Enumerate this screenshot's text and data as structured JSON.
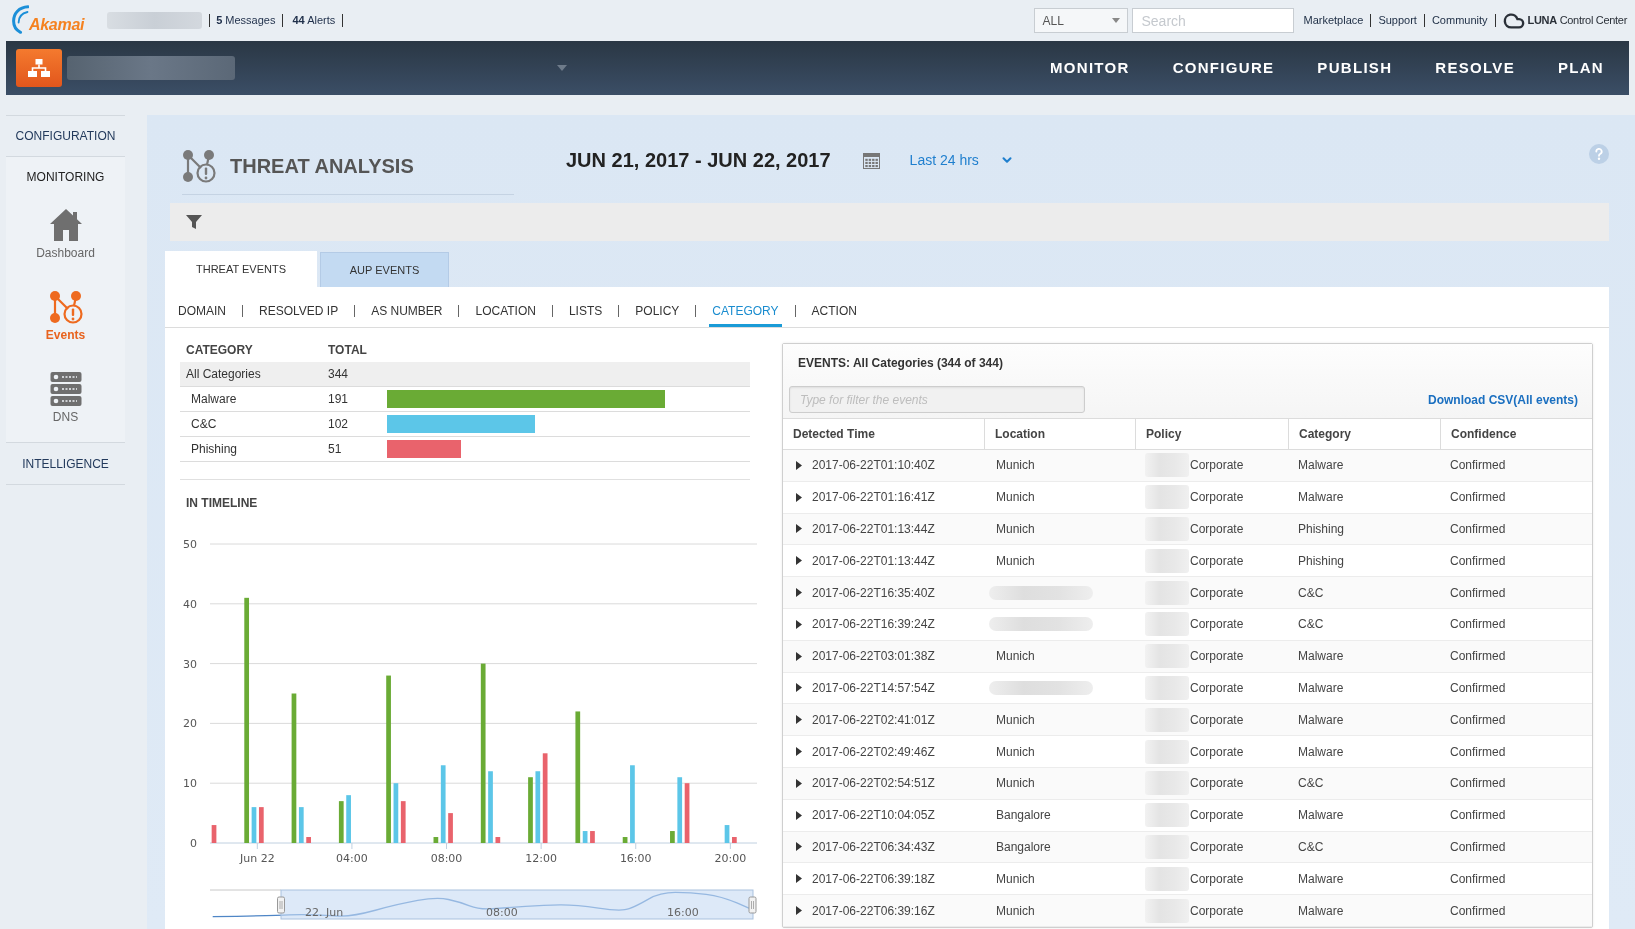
{
  "top_bar": {
    "logo": "Akamai",
    "messages": "**5** Messages",
    "alerts": "**44** Alerts",
    "scope_select": {
      "value": "ALL"
    },
    "search": {
      "placeholder": "Search"
    },
    "links": [
      "Marketplace",
      "Support",
      "Community"
    ],
    "product": "**LUNA** Control Center"
  },
  "nav": {
    "items": [
      "MONITOR",
      "CONFIGURE",
      "PUBLISH",
      "RESOLVE",
      "PLAN"
    ]
  },
  "sidebar": {
    "sections": [
      {
        "label": "CONFIGURATION",
        "expanded": false
      },
      {
        "label": "MONITORING",
        "expanded": true,
        "items": [
          {
            "label": "Dashboard",
            "kind": "house",
            "selected": false
          },
          {
            "label": "Events",
            "kind": "nodes",
            "selected": true
          },
          {
            "label": "DNS",
            "kind": "servers",
            "selected": false
          }
        ]
      },
      {
        "label": "INTELLIGENCE",
        "expanded": false
      }
    ]
  },
  "header": {
    "title": "THREAT ANALYSIS",
    "date_range": "JUN 21, 2017 - JUN 22, 2017",
    "period": "Last 24 hrs"
  },
  "tabs": [
    {
      "label": "THREAT EVENTS",
      "selected": true
    },
    {
      "label": "AUP EVENTS",
      "selected": false
    }
  ],
  "sub_tabs": [
    {
      "label": "DOMAIN",
      "selected": false
    },
    {
      "label": "RESOLVED IP",
      "selected": false
    },
    {
      "label": "AS NUMBER",
      "selected": false
    },
    {
      "label": "LOCATION",
      "selected": false
    },
    {
      "label": "LISTS",
      "selected": false
    },
    {
      "label": "POLICY",
      "selected": false
    },
    {
      "label": "CATEGORY",
      "selected": true
    },
    {
      "label": "ACTION",
      "selected": false
    }
  ],
  "category_table": {
    "columns": [
      "CATEGORY",
      "TOTAL"
    ],
    "rows": [
      {
        "name": "All Categories",
        "total": "344",
        "selected": true,
        "children": [
          {
            "name": "Malware",
            "total": "191",
            "color": "#6aab35",
            "selected": false
          },
          {
            "name": "C&C",
            "total": "102",
            "color": "#5cc6e8",
            "selected": false
          },
          {
            "name": "Phishing",
            "total": "51",
            "color": "#e9636c",
            "selected": false
          }
        ]
      }
    ]
  },
  "timeline": {
    "title": "IN TIMELINE",
    "chart_data": {
      "type": "bar",
      "x": [
        -2,
        0,
        2,
        4,
        6,
        8,
        10,
        12,
        14,
        16,
        18,
        20
      ],
      "series": [
        {
          "color": "#6aab35",
          "values": [
            0,
            41,
            25,
            7,
            28,
            1,
            30,
            11,
            22,
            1,
            2,
            0
          ]
        },
        {
          "color": "#5cc6e8",
          "values": [
            0,
            6,
            6,
            8,
            10,
            13,
            12,
            12,
            2,
            13,
            11,
            3
          ]
        },
        {
          "color": "#e9636c",
          "values": [
            3,
            6,
            1,
            0,
            7,
            5,
            1,
            15,
            2,
            0,
            10,
            1
          ]
        }
      ],
      "xlim": [
        -2,
        21
      ],
      "ylim": [
        0,
        50
      ],
      "xticks": [
        {
          "value": 0,
          "label": "Jun 22"
        },
        {
          "value": 4,
          "label": "04:00"
        },
        {
          "value": 8,
          "label": "08:00"
        },
        {
          "value": 12,
          "label": "12:00"
        },
        {
          "value": 16,
          "label": "16:00"
        },
        {
          "value": 20,
          "label": "20:00"
        }
      ],
      "yticks": [
        0,
        10,
        20,
        30,
        40,
        50
      ],
      "grid": true
    },
    "navigator": {
      "labels": [
        "22. Jun",
        "08:00",
        "16:00"
      ]
    }
  },
  "events": {
    "title": "EVENTS: All Categories (344 of 344)",
    "filter": {
      "placeholder": "Type for filter the events"
    },
    "download": "Download CSV(All events)",
    "columns": [
      "Detected Time",
      "Location",
      "Policy",
      "Category",
      "Confidence"
    ],
    "rows": [
      {
        "time": "2017-06-22T01:10:40Z",
        "location": "Munich",
        "policy": "Corporate",
        "category": "Malware",
        "confidence": "Confirmed",
        "expanded": false
      },
      {
        "time": "2017-06-22T01:16:41Z",
        "location": "Munich",
        "policy": "Corporate",
        "category": "Malware",
        "confidence": "Confirmed",
        "expanded": false
      },
      {
        "time": "2017-06-22T01:13:44Z",
        "location": "Munich",
        "policy": "Corporate",
        "category": "Phishing",
        "confidence": "Confirmed",
        "expanded": false
      },
      {
        "time": "2017-06-22T01:13:44Z",
        "location": "Munich",
        "policy": "Corporate",
        "category": "Phishing",
        "confidence": "Confirmed",
        "expanded": false
      },
      {
        "time": "2017-06-22T16:35:40Z",
        "location_redacted": true,
        "policy": "Corporate",
        "category": "C&C",
        "confidence": "Confirmed",
        "expanded": false
      },
      {
        "time": "2017-06-22T16:39:24Z",
        "location_redacted": true,
        "policy": "Corporate",
        "category": "C&C",
        "confidence": "Confirmed",
        "expanded": false
      },
      {
        "time": "2017-06-22T03:01:38Z",
        "location": "Munich",
        "policy": "Corporate",
        "category": "Malware",
        "confidence": "Confirmed",
        "expanded": false
      },
      {
        "time": "2017-06-22T14:57:54Z",
        "location_redacted": true,
        "policy": "Corporate",
        "category": "Malware",
        "confidence": "Confirmed",
        "expanded": false
      },
      {
        "time": "2017-06-22T02:41:01Z",
        "location": "Munich",
        "policy": "Corporate",
        "category": "Malware",
        "confidence": "Confirmed",
        "expanded": false
      },
      {
        "time": "2017-06-22T02:49:46Z",
        "location": "Munich",
        "policy": "Corporate",
        "category": "Malware",
        "confidence": "Confirmed",
        "expanded": false
      },
      {
        "time": "2017-06-22T02:54:51Z",
        "location": "Munich",
        "policy": "Corporate",
        "category": "C&C",
        "confidence": "Confirmed",
        "expanded": false
      },
      {
        "time": "2017-06-22T10:04:05Z",
        "location": "Bangalore",
        "policy": "Corporate",
        "category": "Malware",
        "confidence": "Confirmed",
        "expanded": false
      },
      {
        "time": "2017-06-22T06:34:43Z",
        "location": "Bangalore",
        "policy": "Corporate",
        "category": "C&C",
        "confidence": "Confirmed",
        "expanded": false
      },
      {
        "time": "2017-06-22T06:39:18Z",
        "location": "Munich",
        "policy": "Corporate",
        "category": "Malware",
        "confidence": "Confirmed",
        "expanded": false
      },
      {
        "time": "2017-06-22T06:39:16Z",
        "location": "Munich",
        "policy": "Corporate",
        "category": "Malware",
        "confidence": "Confirmed",
        "expanded": false
      }
    ]
  }
}
